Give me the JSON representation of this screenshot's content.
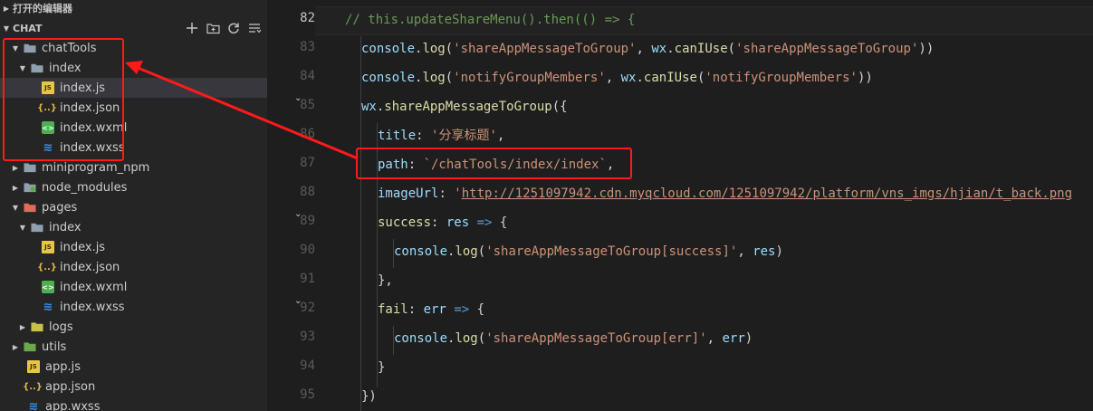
{
  "sidebar": {
    "open_editors_label": "打开的编辑器",
    "workspace_label": "CHAT",
    "actions": [
      "new-file-icon",
      "new-folder-icon",
      "refresh-icon",
      "collapse-all-icon"
    ],
    "tree": [
      {
        "label": "chatTools",
        "type": "folder",
        "expanded": true
      },
      {
        "label": "index",
        "type": "folder",
        "expanded": true
      },
      {
        "label": "index.js",
        "type": "js"
      },
      {
        "label": "index.json",
        "type": "json"
      },
      {
        "label": "index.wxml",
        "type": "wxml"
      },
      {
        "label": "index.wxss",
        "type": "wxss"
      },
      {
        "label": "miniprogram_npm",
        "type": "folder",
        "expanded": false
      },
      {
        "label": "node_modules",
        "type": "folder",
        "expanded": false
      },
      {
        "label": "pages",
        "type": "folder",
        "expanded": true
      },
      {
        "label": "index",
        "type": "folder",
        "expanded": true
      },
      {
        "label": "index.js",
        "type": "js"
      },
      {
        "label": "index.json",
        "type": "json"
      },
      {
        "label": "index.wxml",
        "type": "wxml"
      },
      {
        "label": "index.wxss",
        "type": "wxss"
      },
      {
        "label": "logs",
        "type": "folder",
        "expanded": false
      },
      {
        "label": "utils",
        "type": "folder",
        "expanded": false
      },
      {
        "label": "app.js",
        "type": "js"
      },
      {
        "label": "app.json",
        "type": "json"
      },
      {
        "label": "app.wxss",
        "type": "wxss"
      }
    ]
  },
  "editor": {
    "current_line": "82",
    "line_numbers": [
      "82",
      "83",
      "84",
      "85",
      "86",
      "87",
      "88",
      "89",
      "90",
      "91",
      "92",
      "93",
      "94",
      "95"
    ],
    "lines": {
      "l82_comment": "// this.updateShareMenu().then(() => {",
      "l83_console": "console",
      "l83_log": "log",
      "l83_str": "'shareAppMessageToGroup'",
      "l83_wx": "wx",
      "l83_caniuse": "canIUse",
      "l83_arg": "'shareAppMessageToGroup'",
      "l84_console": "console",
      "l84_log": "log",
      "l84_str": "'notifyGroupMembers'",
      "l84_wx": "wx",
      "l84_caniuse": "canIUse",
      "l84_arg": "'notifyGroupMembers'",
      "l85_wx": "wx",
      "l85_fn": "shareAppMessageToGroup",
      "l86_key": "title",
      "l86_val": "'分享标题'",
      "l87_key": "path",
      "l87_val": "`/chatTools/index/index`",
      "l88_key": "imageUrl",
      "l88_quote": "'",
      "l88_url": "http://1251097942.cdn.myqcloud.com/1251097942/platform/vns_imgs/hjian/t_back.png",
      "l89_key": "success",
      "l89_param": "res",
      "l89_arrow": "=>",
      "l90_console": "console",
      "l90_log": "log",
      "l90_str": "'shareAppMessageToGroup[success]'",
      "l90_param": "res",
      "l91_text": "},",
      "l92_key": "fail",
      "l92_param": "err",
      "l92_arrow": "=>",
      "l93_console": "console",
      "l93_log": "log",
      "l93_str": "'shareAppMessageToGroup[err]'",
      "l93_param": "err",
      "l94_text": "}",
      "l95_text": "})"
    }
  },
  "colors": {
    "annotation": "#ff1a1a",
    "comment": "#6a9955",
    "string": "#ce9178",
    "function": "#dcdcaa",
    "property": "#9cdcfe",
    "keyword": "#569cd6"
  }
}
